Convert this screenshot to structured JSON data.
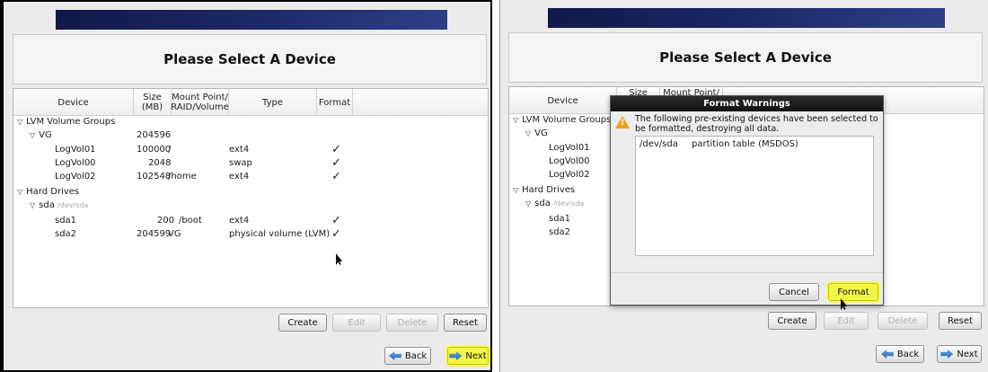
{
  "colors": {
    "banner": "#1d2a6a",
    "highlight": "#f3f547",
    "dialog_title_bg": "#1a1a1a",
    "warning": "#f0a010"
  },
  "title": "Please Select A Device",
  "columns": {
    "device": "Device",
    "size": "Size\n(MB)",
    "mount": "Mount Point/\nRAID/Volume",
    "type": "Type",
    "format": "Format"
  },
  "right_columns": {
    "device": "Device",
    "size": "Size",
    "mount": "Mount Point/"
  },
  "tree": {
    "lvm_groups": "LVM Volume Groups",
    "vg": {
      "name": "VG",
      "size": "204596"
    },
    "logvols": [
      {
        "name": "LogVol01",
        "size": "100000",
        "mount": "/",
        "type": "ext4",
        "format": "✓"
      },
      {
        "name": "LogVol00",
        "size": "2048",
        "mount": "",
        "type": "swap",
        "format": "✓"
      },
      {
        "name": "LogVol02",
        "size": "102548",
        "mount": "/home",
        "type": "ext4",
        "format": "✓"
      }
    ],
    "hard_drives": "Hard Drives",
    "sda": {
      "name": "sda",
      "path": "/dev/sda"
    },
    "partitions": [
      {
        "name": "sda1",
        "size": "200",
        "mount": "/boot",
        "type": "ext4",
        "format": "✓"
      },
      {
        "name": "sda2",
        "size": "204599",
        "mount": "VG",
        "type": "physical volume (LVM)",
        "format": "✓"
      }
    ]
  },
  "buttons": {
    "create": "Create",
    "edit": "Edit",
    "delete": "Delete",
    "reset": "Reset",
    "back": "Back",
    "next": "Next"
  },
  "dialog": {
    "title": "Format Warnings",
    "message": "The following pre-existing devices have been selected to be formatted, destroying all data.",
    "items": [
      {
        "device": "/dev/sda",
        "description": "partition table (MSDOS)"
      }
    ],
    "cancel": "Cancel",
    "format": "Format"
  }
}
